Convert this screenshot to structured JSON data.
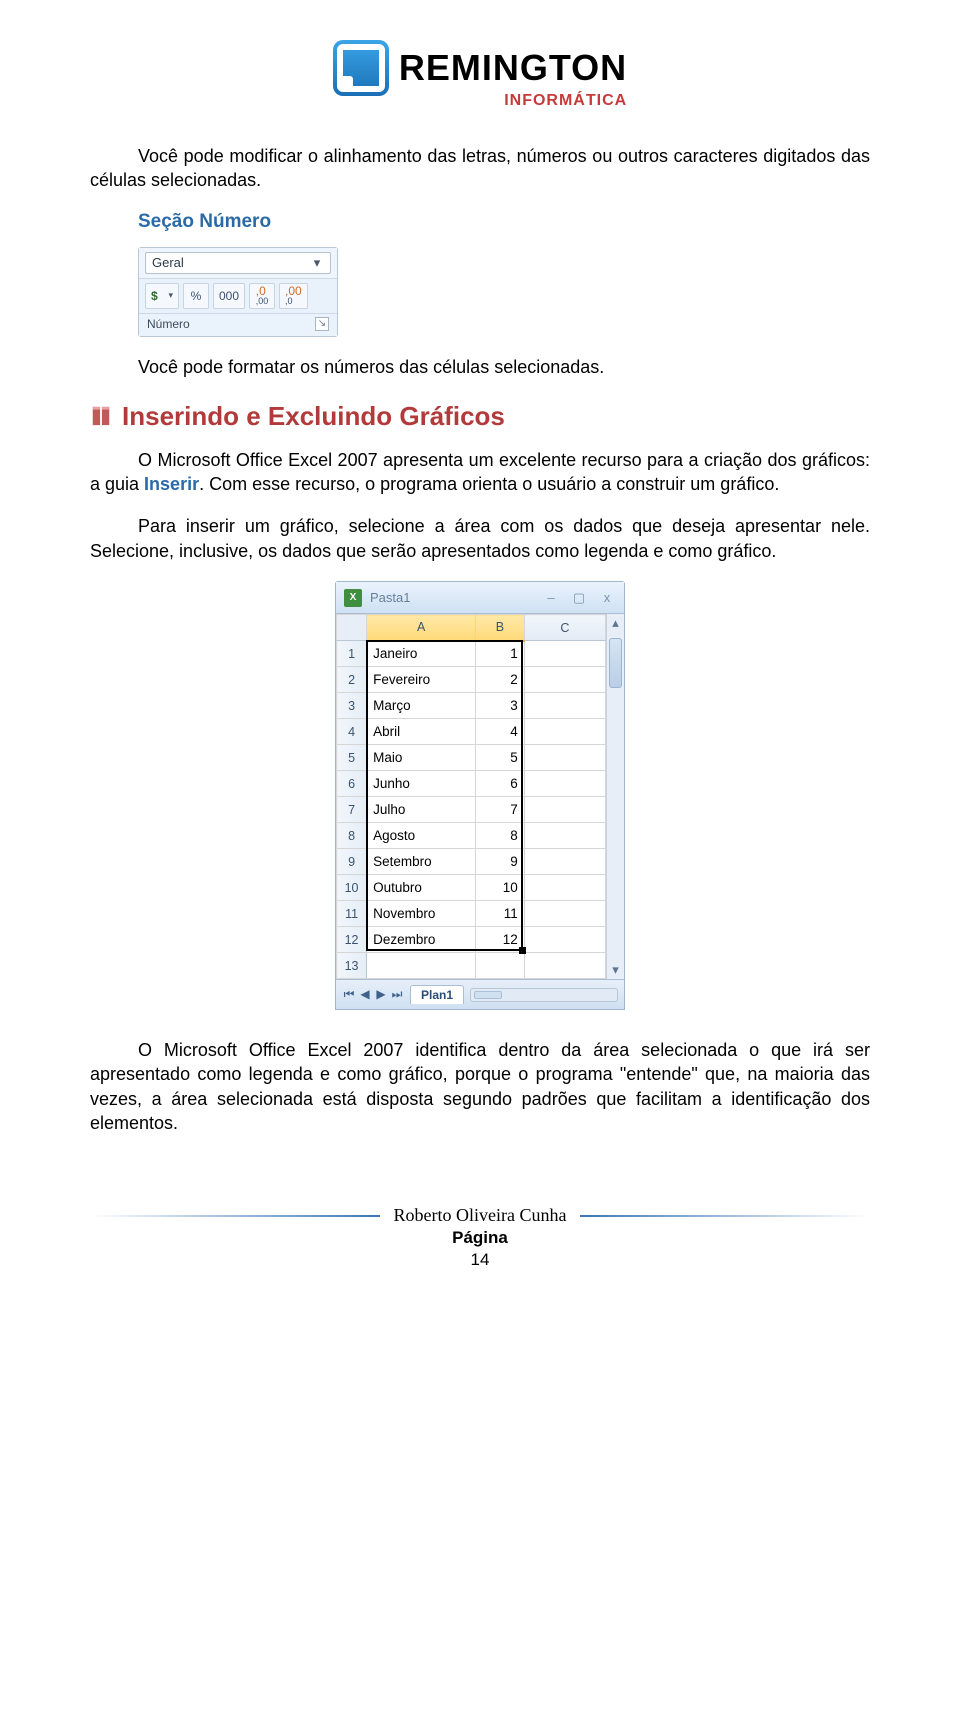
{
  "logo": {
    "brand": "REMINGTON",
    "subtitle": "INFORMÁTICA"
  },
  "intro": {
    "p1": "Você pode modificar o alinhamento das letras, números ou outros caracteres digitados das células selecionadas.",
    "section_title": "Seção Número",
    "p2": "Você pode formatar os números das células selecionadas."
  },
  "ribbon": {
    "dropdown_value": "Geral",
    "btn_currency": "$",
    "btn_percent": "%",
    "btn_thousand": "000",
    "btn_inc": ",0",
    "btn_inc_sub": ",00",
    "btn_dec": ",00",
    "btn_dec_sub": ",0",
    "group_label": "Número"
  },
  "h2": "Inserindo e Excluindo Gráficos",
  "body": {
    "p1a": "O Microsoft Office Excel 2007 apresenta um excelente recurso para a criação dos gráficos: a guia ",
    "p1_link": "Inserir",
    "p1b": ". Com esse recurso, o programa orienta o usuário a construir um gráfico.",
    "p2": "Para inserir um gráfico, selecione a área com os dados que deseja apresentar nele. Selecione, inclusive, os dados que serão apresentados como legenda e como gráfico.",
    "p3": "O Microsoft Office Excel 2007 identifica dentro da área selecionada o que irá ser apresentado como legenda e como gráfico, porque o programa \"entende\" que, na maioria das vezes, a área selecionada está disposta segundo padrões que facilitam a identificação dos elementos."
  },
  "excel": {
    "title": "Pasta1",
    "columns": [
      "A",
      "B",
      "C"
    ],
    "rows": [
      {
        "n": 1,
        "a": "Janeiro",
        "b": "1"
      },
      {
        "n": 2,
        "a": "Fevereiro",
        "b": "2"
      },
      {
        "n": 3,
        "a": "Março",
        "b": "3"
      },
      {
        "n": 4,
        "a": "Abril",
        "b": "4"
      },
      {
        "n": 5,
        "a": "Maio",
        "b": "5"
      },
      {
        "n": 6,
        "a": "Junho",
        "b": "6"
      },
      {
        "n": 7,
        "a": "Julho",
        "b": "7"
      },
      {
        "n": 8,
        "a": "Agosto",
        "b": "8"
      },
      {
        "n": 9,
        "a": "Setembro",
        "b": "9"
      },
      {
        "n": 10,
        "a": "Outubro",
        "b": "10"
      },
      {
        "n": 11,
        "a": "Novembro",
        "b": "11"
      },
      {
        "n": 12,
        "a": "Dezembro",
        "b": "12"
      },
      {
        "n": 13,
        "a": "",
        "b": ""
      }
    ],
    "sheet_tab": "Plan1"
  },
  "footer": {
    "author": "Roberto Oliveira Cunha",
    "page_label": "Página",
    "page_number": "14"
  }
}
